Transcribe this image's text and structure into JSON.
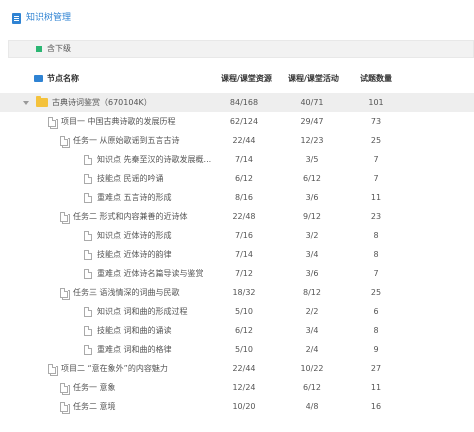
{
  "title": "知识树管理",
  "toolbar": {
    "include_children_label": "含下级"
  },
  "columns": {
    "name": "节点名称",
    "resources": "课程/课堂资源",
    "activities": "课程/课堂活动",
    "questions": "试题数量"
  },
  "rows": [
    {
      "level": 0,
      "kind": "root",
      "name": "古典诗词鉴赏（670104K）",
      "resources": "84/168",
      "activities": "40/71",
      "questions": "101"
    },
    {
      "level": 1,
      "kind": "project",
      "name": "项目一 中国古典诗歌的发展历程",
      "resources": "62/124",
      "activities": "29/47",
      "questions": "73"
    },
    {
      "level": 2,
      "kind": "task",
      "name": "任务一 从原始歌谣到五言古诗",
      "resources": "22/44",
      "activities": "12/23",
      "questions": "25"
    },
    {
      "level": 3,
      "kind": "point",
      "name": "知识点 先秦至汉的诗歌发展概...",
      "resources": "7/14",
      "activities": "3/5",
      "questions": "7"
    },
    {
      "level": 3,
      "kind": "point",
      "name": "技能点 民谣的吟诵",
      "resources": "6/12",
      "activities": "6/12",
      "questions": "7"
    },
    {
      "level": 3,
      "kind": "point",
      "name": "重难点 五言诗的形成",
      "resources": "8/16",
      "activities": "3/6",
      "questions": "11"
    },
    {
      "level": 2,
      "kind": "task",
      "name": "任务二 形式和内容兼善的近诗体",
      "resources": "22/48",
      "activities": "9/12",
      "questions": "23"
    },
    {
      "level": 3,
      "kind": "point",
      "name": "知识点 近体诗的形成",
      "resources": "7/16",
      "activities": "3/2",
      "questions": "8"
    },
    {
      "level": 3,
      "kind": "point",
      "name": "技能点 近体诗的韵律",
      "resources": "7/14",
      "activities": "3/4",
      "questions": "8"
    },
    {
      "level": 3,
      "kind": "point",
      "name": "重难点 近体诗名篇导读与鉴赏",
      "resources": "7/12",
      "activities": "3/6",
      "questions": "7"
    },
    {
      "level": 2,
      "kind": "task",
      "name": "任务三 语浅情深的词曲与民歌",
      "resources": "18/32",
      "activities": "8/12",
      "questions": "25"
    },
    {
      "level": 3,
      "kind": "point",
      "name": "知识点 词和曲的形成过程",
      "resources": "5/10",
      "activities": "2/2",
      "questions": "6"
    },
    {
      "level": 3,
      "kind": "point",
      "name": "技能点 词和曲的诵读",
      "resources": "6/12",
      "activities": "3/4",
      "questions": "8"
    },
    {
      "level": 3,
      "kind": "point",
      "name": "重难点 词和曲的格律",
      "resources": "5/10",
      "activities": "2/4",
      "questions": "9"
    },
    {
      "level": 1,
      "kind": "project",
      "name": "项目二 “意在象外”的内容魅力",
      "resources": "22/44",
      "activities": "10/22",
      "questions": "27"
    },
    {
      "level": 2,
      "kind": "task",
      "name": "任务一 意象",
      "resources": "12/24",
      "activities": "6/12",
      "questions": "11"
    },
    {
      "level": 2,
      "kind": "task",
      "name": "任务二 意境",
      "resources": "10/20",
      "activities": "4/8",
      "questions": "16"
    }
  ]
}
